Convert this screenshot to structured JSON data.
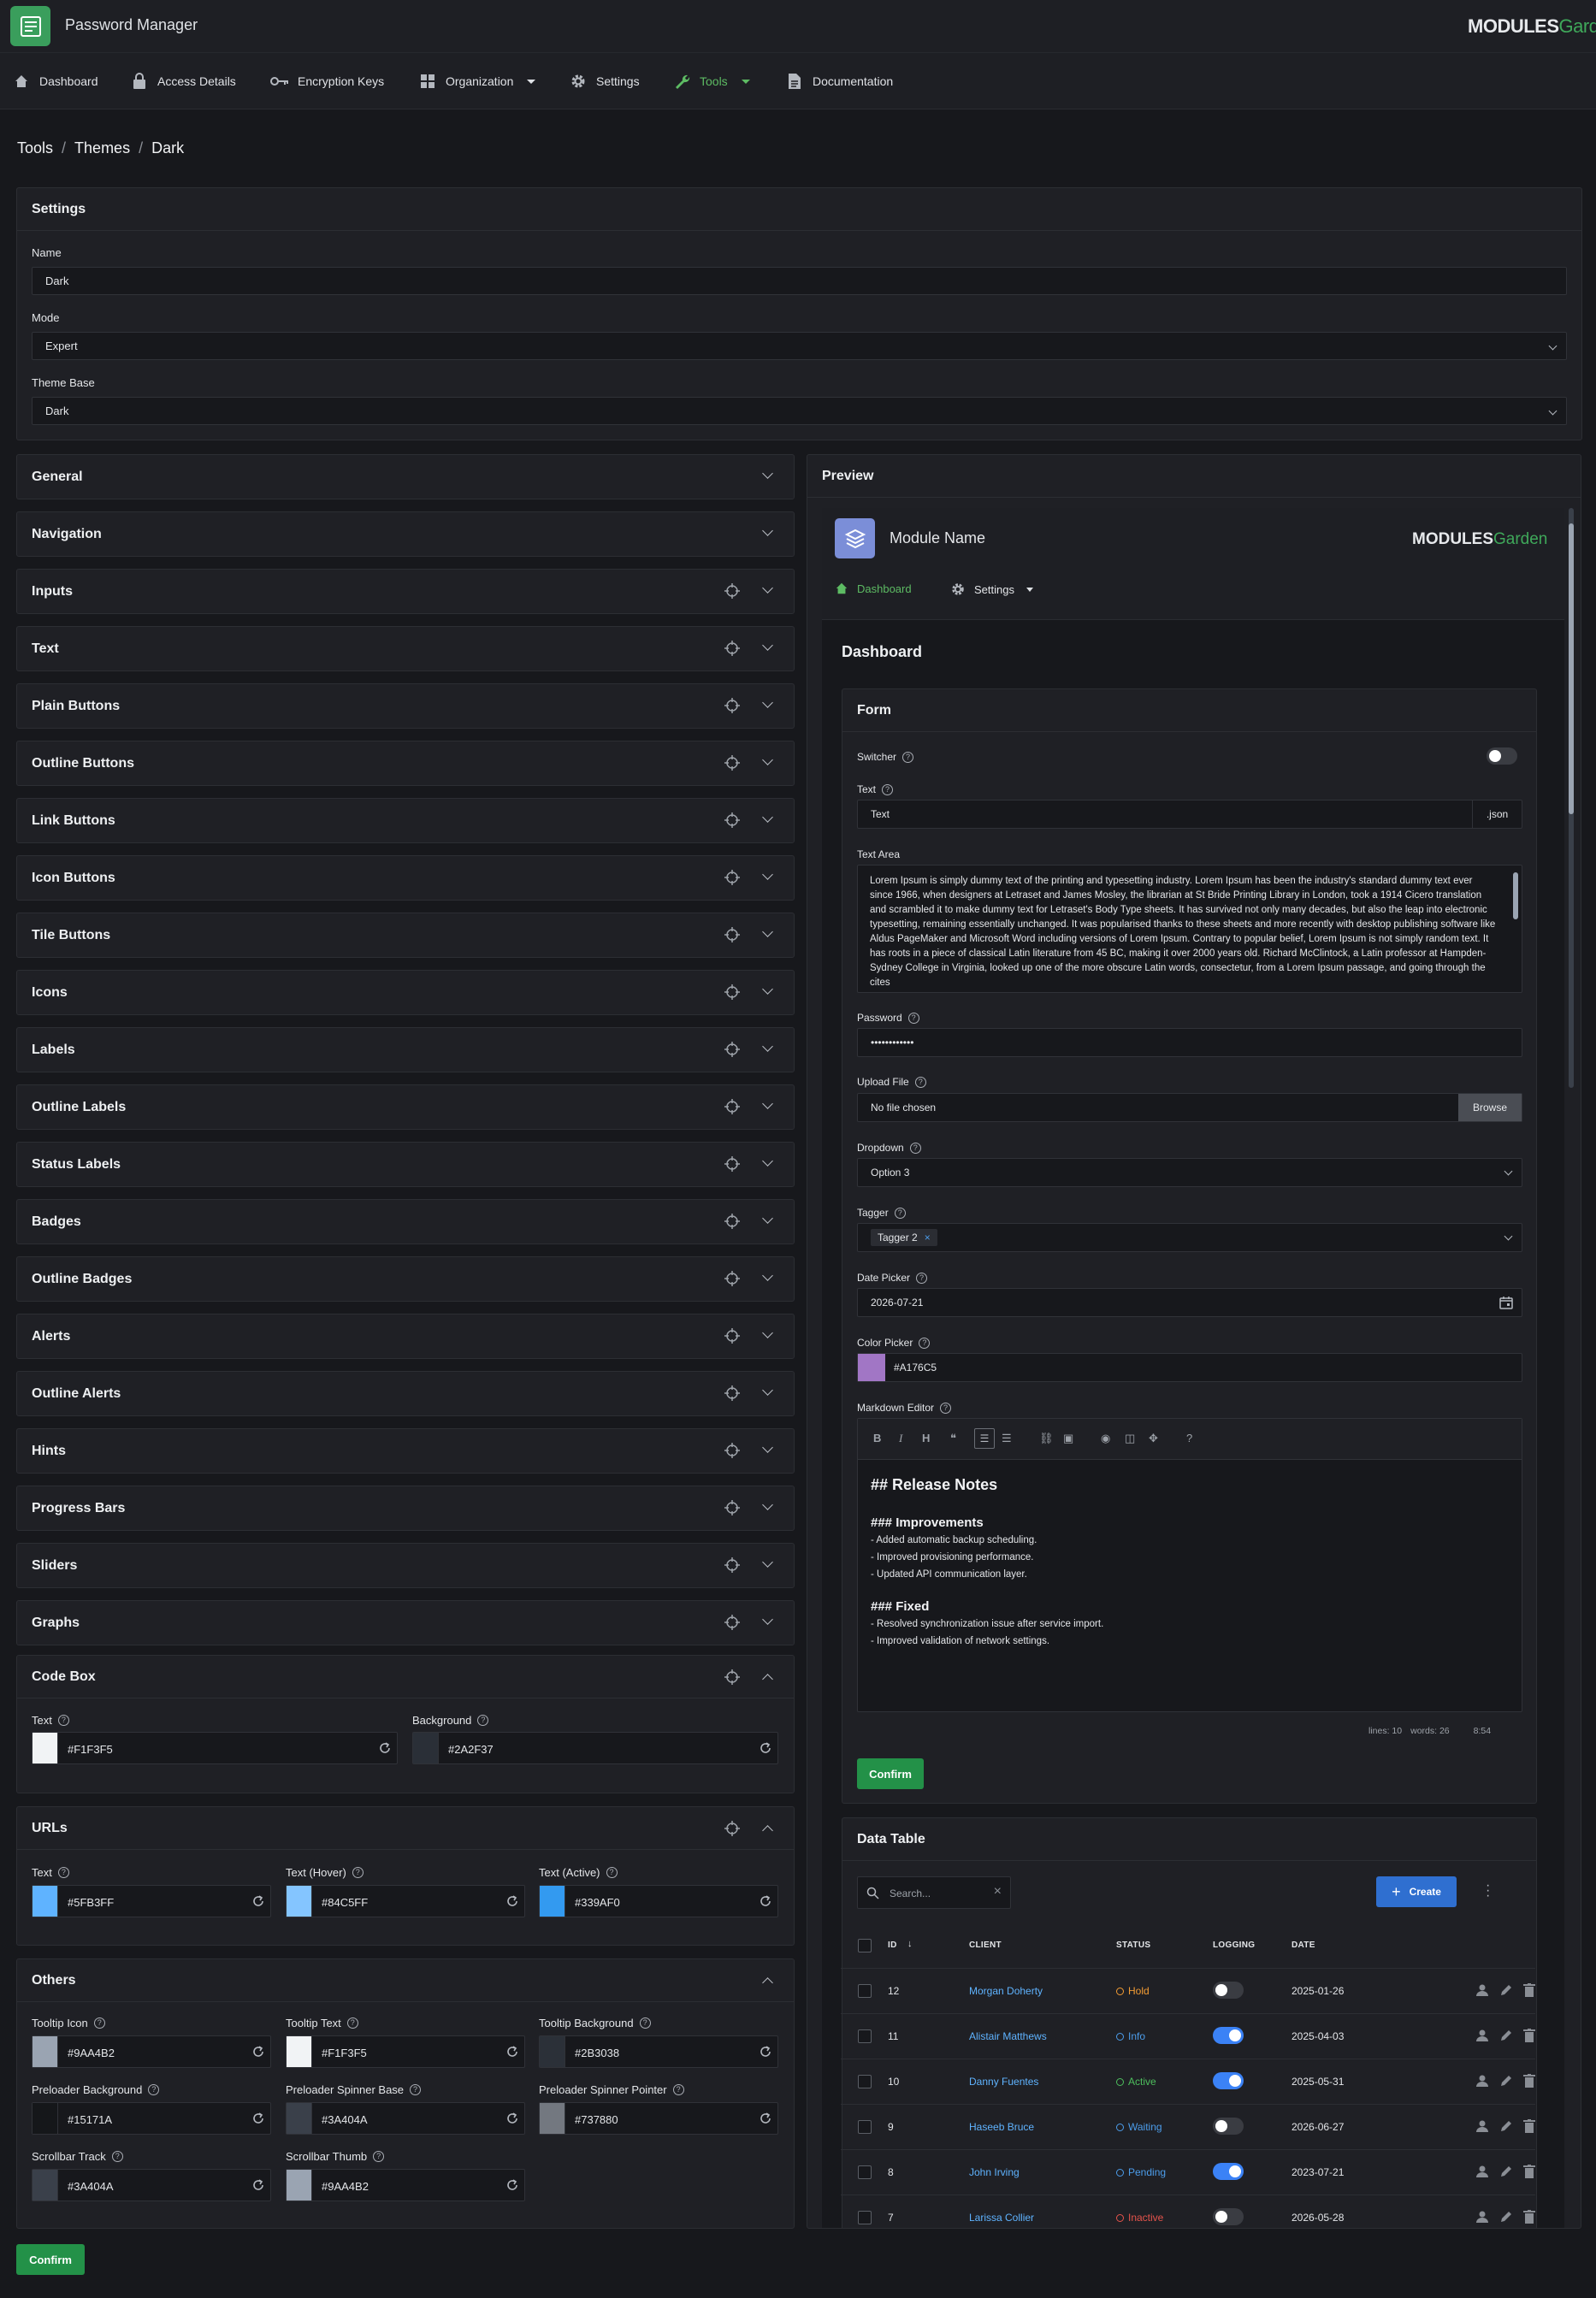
{
  "app": {
    "title": "Password Manager",
    "logo_main": "MODULES",
    "logo_accent": "Garden"
  },
  "nav": [
    {
      "label": "Dashboard",
      "icon": "home-icon"
    },
    {
      "label": "Access Details",
      "icon": "lock-icon"
    },
    {
      "label": "Encryption Keys",
      "icon": "key-icon"
    },
    {
      "label": "Organization",
      "icon": "grid-icon"
    },
    {
      "label": "Settings",
      "icon": "gear-icon"
    },
    {
      "label": "Tools",
      "icon": "wrench-icon"
    },
    {
      "label": "Documentation",
      "icon": "document-icon"
    }
  ],
  "breadcrumb": [
    "Tools",
    "Themes",
    "Dark"
  ],
  "settings": {
    "title": "Settings",
    "name_label": "Name",
    "name_value": "Dark",
    "mode_label": "Mode",
    "mode_value": "Expert",
    "base_label": "Theme Base",
    "base_value": "Dark"
  },
  "accordions": [
    "General",
    "Navigation",
    "Inputs",
    "Text",
    "Plain Buttons",
    "Outline Buttons",
    "Link Buttons",
    "Icon Buttons",
    "Tile Buttons",
    "Icons",
    "Labels",
    "Outline Labels",
    "Status Labels",
    "Badges",
    "Outline Badges",
    "Alerts",
    "Outline Alerts",
    "Hints",
    "Progress Bars",
    "Sliders",
    "Graphs"
  ],
  "codebox": {
    "title": "Code Box",
    "text_label": "Text",
    "text_value": "#F1F3F5",
    "text_color": "#F1F3F5",
    "bg_label": "Background",
    "bg_value": "#2A2F37",
    "bg_color": "#2A2F37"
  },
  "urls": {
    "title": "URLs",
    "text_label": "Text",
    "text_value": "#5FB3FF",
    "hover_label": "Text (Hover)",
    "hover_value": "#84C5FF",
    "active_label": "Text (Active)",
    "active_value": "#339AF0"
  },
  "others": {
    "title": "Others",
    "fields": [
      {
        "label": "Tooltip Icon",
        "value": "#9AA4B2"
      },
      {
        "label": "Tooltip Text",
        "value": "#F1F3F5"
      },
      {
        "label": "Tooltip Background",
        "value": "#2B3038"
      },
      {
        "label": "Preloader Background",
        "value": "#15171A"
      },
      {
        "label": "Preloader Spinner Base",
        "value": "#3A404A"
      },
      {
        "label": "Preloader Spinner Pointer",
        "value": "#737880"
      },
      {
        "label": "Scrollbar Track",
        "value": "#3A404A"
      },
      {
        "label": "Scrollbar Thumb",
        "value": "#9AA4B2"
      }
    ]
  },
  "confirm_label": "Confirm",
  "preview": {
    "title": "Preview",
    "module_name": "Module Name",
    "nav": [
      {
        "label": "Dashboard"
      },
      {
        "label": "Settings"
      }
    ],
    "page_title": "Dashboard",
    "form": {
      "title": "Form",
      "switcher_label": "Switcher",
      "text_label": "Text",
      "text_value": "Text",
      "text_addon": ".json",
      "textarea_label": "Text Area",
      "textarea_value": "Lorem Ipsum is simply dummy text of the printing and typesetting industry. Lorem Ipsum has been the industry's standard dummy text ever since 1966, when designers at Letraset and James Mosley, the librarian at St Bride Printing Library in London, took a 1914 Cicero translation and scrambled it to make dummy text for Letraset's Body Type sheets. It has survived not only many decades, but also the leap into electronic typesetting, remaining essentially unchanged. It was popularised thanks to these sheets and more recently with desktop publishing software like Aldus PageMaker and Microsoft Word including versions of Lorem Ipsum. Contrary to popular belief, Lorem Ipsum is not simply random text. It has roots in a piece of classical Latin literature from 45 BC, making it over 2000 years old. Richard McClintock, a Latin professor at Hampden-Sydney College in Virginia, looked up one of the more obscure Latin words, consectetur, from a Lorem Ipsum passage, and going through the cites",
      "password_label": "Password",
      "password_value": "••••••••••••",
      "upload_label": "Upload File",
      "upload_value": "No file chosen",
      "upload_button": "Browse",
      "dropdown_label": "Dropdown",
      "dropdown_value": "Option 3",
      "tagger_label": "Tagger",
      "tagger_tag": "Tagger 2",
      "date_label": "Date Picker",
      "date_value": "2026-07-21",
      "color_label": "Color Picker",
      "color_value": "#A176C5",
      "md_label": "Markdown Editor",
      "md_lines": [
        "## Release Notes",
        "",
        "### Improvements",
        "- Added automatic backup scheduling.",
        "- Improved provisioning performance.",
        "- Updated API communication layer.",
        "",
        "### Fixed",
        "- Resolved synchronization issue after service import.",
        "- Improved validation of network settings."
      ],
      "md_status_lines": "lines: 10",
      "md_status_words": "words: 26",
      "md_status_pos": "8:54",
      "confirm": "Confirm"
    },
    "table": {
      "title": "Data Table",
      "search_placeholder": "Search...",
      "create": "Create",
      "headers": [
        "ID",
        "CLIENT",
        "STATUS",
        "LOGGING",
        "DATE"
      ],
      "rows": [
        {
          "id": "12",
          "client": "Morgan Doherty",
          "status": "Hold",
          "status_color": "#F39C34",
          "logging": false,
          "date": "2025-01-26"
        },
        {
          "id": "11",
          "client": "Alistair Matthews",
          "status": "Info",
          "status_color": "#4C9DEB",
          "logging": true,
          "date": "2025-04-03"
        },
        {
          "id": "10",
          "client": "Danny Fuentes",
          "status": "Active",
          "status_color": "#4DBE5D",
          "logging": true,
          "date": "2025-05-31"
        },
        {
          "id": "9",
          "client": "Haseeb Bruce",
          "status": "Waiting",
          "status_color": "#4C9DEB",
          "logging": false,
          "date": "2026-06-27"
        },
        {
          "id": "8",
          "client": "John Irving",
          "status": "Pending",
          "status_color": "#4C9DEB",
          "logging": true,
          "date": "2023-07-21"
        },
        {
          "id": "7",
          "client": "Larissa Collier",
          "status": "Inactive",
          "status_color": "#E5534B",
          "logging": false,
          "date": "2026-05-28"
        }
      ]
    }
  }
}
